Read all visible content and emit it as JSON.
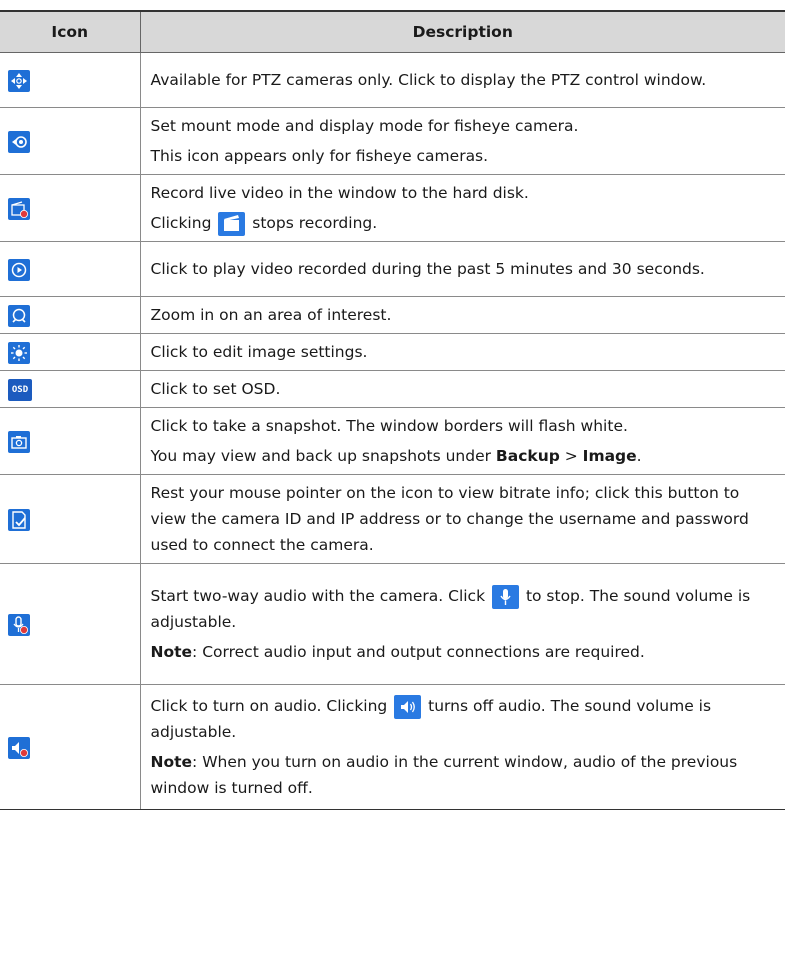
{
  "table": {
    "headers": {
      "icon": "Icon",
      "description": "Description"
    },
    "rows": [
      {
        "icon": "ptz-icon",
        "lines": [
          "Available for PTZ cameras only. Click to display the PTZ control window."
        ]
      },
      {
        "icon": "fisheye-icon",
        "lines": [
          "Set mount mode and display mode for fisheye camera.",
          "This icon appears only for fisheye cameras."
        ]
      },
      {
        "icon": "record-icon",
        "line1": "Record live video in the window to the hard disk.",
        "line2_pre": "Clicking",
        "inline_icon": "stop-record-icon",
        "line2_post": "stops recording."
      },
      {
        "icon": "playback-icon",
        "lines": [
          "Click to play video recorded during the past 5 minutes and 30 seconds."
        ]
      },
      {
        "icon": "zoom-icon",
        "lines": [
          "Zoom in on an area of interest."
        ]
      },
      {
        "icon": "image-settings-icon",
        "lines": [
          "Click to edit image settings."
        ]
      },
      {
        "icon": "osd-icon",
        "icon_text": "OSD",
        "lines": [
          "Click to set OSD."
        ]
      },
      {
        "icon": "snapshot-icon",
        "line1": "Click to take a snapshot. The window borders will flash white.",
        "line2_pre": "You may view and back up snapshots under ",
        "bold1": "Backup",
        "sep": " > ",
        "bold2": "Image",
        "line2_post": "."
      },
      {
        "icon": "camera-info-icon",
        "lines": [
          "Rest your mouse pointer on the icon to view bitrate info; click this button to view the camera ID and IP address or to change the username and password used to connect the camera."
        ]
      },
      {
        "icon": "two-way-audio-icon",
        "line1_pre": "Start two-way audio with the camera. Click",
        "inline_icon": "microphone-stop-icon",
        "line1_post": "to stop. The sound volume is adjustable.",
        "note_label": "Note",
        "note_text": ": Correct audio input and output connections are required."
      },
      {
        "icon": "audio-icon",
        "line1_pre": "Click to turn on audio. Clicking",
        "inline_icon": "speaker-icon",
        "line1_post": "turns off audio. The sound volume is adjustable.",
        "note_label": "Note",
        "note_text": ": When you turn on audio in the current window, audio of the previous window is turned off."
      }
    ]
  },
  "colors": {
    "header_bg": "#d8d8d8",
    "icon_blue": "#1f6fd6",
    "border": "#8a8a8a"
  }
}
